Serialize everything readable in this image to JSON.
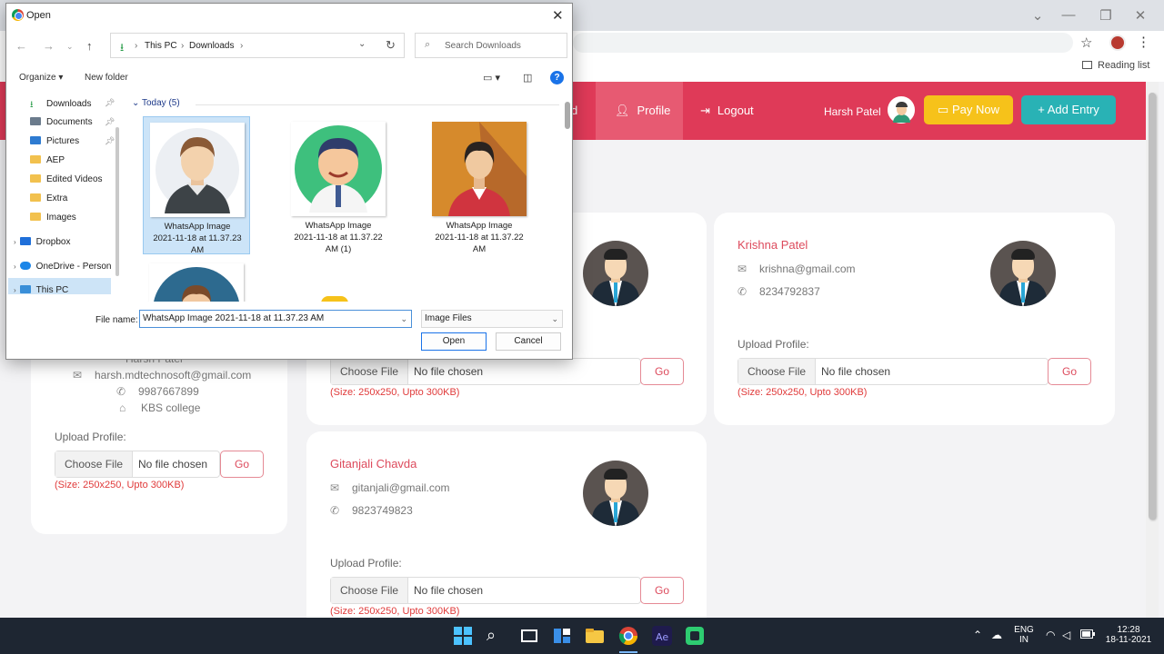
{
  "browser": {
    "reading_list_label": "Reading list"
  },
  "navbar": {
    "profile_label": "Profile",
    "logout_label": "Logout",
    "username": "Harsh Patel",
    "pay_now_label": "Pay Now",
    "add_entry_label": "Add Entry",
    "clipped_item_text": "d",
    "colors": {
      "nav": "#df3a58",
      "pay": "#f6c21a",
      "add": "#29b2b5"
    }
  },
  "cards": {
    "left": {
      "name": "Harsh Patel",
      "email": "harsh.mdtechnosoft@gmail.com",
      "phone": "9987667899",
      "college": "KBS college"
    },
    "krishna": {
      "name": "Krishna Patel",
      "email": "krishna@gmail.com",
      "phone": "8234792837"
    },
    "gitanjali": {
      "name": "Gitanjali Chavda",
      "email": "gitanjali@gmail.com",
      "phone": "9823749823"
    },
    "upload_label": "Upload Profile:",
    "choose_file_label": "Choose File",
    "no_file_label": "No file chosen",
    "go_label": "Go",
    "size_hint": "(Size: 250x250, Upto 300KB)"
  },
  "dialog": {
    "title": "Open",
    "path": [
      "This PC",
      "Downloads"
    ],
    "search_placeholder": "Search Downloads",
    "organize_label": "Organize",
    "new_folder_label": "New folder",
    "help_label": "?",
    "tree": [
      {
        "label": "Downloads",
        "icon": "download-icon",
        "pinned": true
      },
      {
        "label": "Documents",
        "icon": "documents-icon",
        "pinned": true
      },
      {
        "label": "Pictures",
        "icon": "pictures-icon",
        "pinned": true
      },
      {
        "label": "AEP",
        "icon": "folder-icon"
      },
      {
        "label": "Edited Videos",
        "icon": "folder-icon"
      },
      {
        "label": "Extra",
        "icon": "folder-icon"
      },
      {
        "label": "Images",
        "icon": "folder-icon"
      },
      {
        "label": "Dropbox",
        "icon": "dropbox-icon"
      },
      {
        "label": "OneDrive - Person",
        "icon": "onedrive-icon"
      },
      {
        "label": "This PC",
        "icon": "pc-icon",
        "selected": true
      }
    ],
    "group_header": "Today (5)",
    "files": [
      {
        "line1": "WhatsApp Image",
        "line2": "2021-11-18 at 11.37.23",
        "line3": "AM"
      },
      {
        "line1": "WhatsApp Image",
        "line2": "2021-11-18 at 11.37.22",
        "line3": "AM (1)"
      },
      {
        "line1": "WhatsApp Image",
        "line2": "2021-11-18 at 11.37.22",
        "line3": "AM"
      }
    ],
    "file_name_label": "File name:",
    "file_name_value": "WhatsApp Image 2021-11-18 at 11.37.23 AM",
    "file_type_value": "Image Files",
    "open_label": "Open",
    "cancel_label": "Cancel"
  },
  "taskbar": {
    "lang1": "ENG",
    "lang2": "IN",
    "time": "12:28",
    "date": "18-11-2021"
  }
}
